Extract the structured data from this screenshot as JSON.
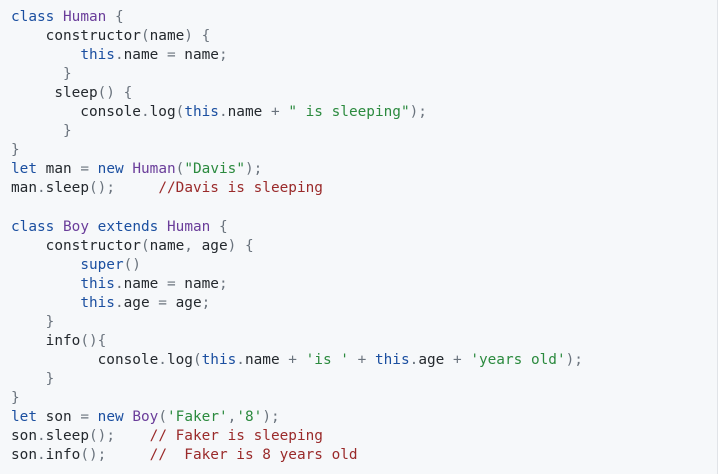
{
  "editor": {
    "lines": [
      [
        {
          "t": "class",
          "k": "kw"
        },
        {
          "t": " "
        },
        {
          "t": "Human",
          "k": "cls"
        },
        {
          "t": " "
        },
        {
          "t": "{",
          "k": "pun"
        }
      ],
      [
        {
          "t": "    constructor"
        },
        {
          "t": "(",
          "k": "pun"
        },
        {
          "t": "name"
        },
        {
          "t": ")",
          "k": "pun"
        },
        {
          "t": " "
        },
        {
          "t": "{",
          "k": "pun"
        }
      ],
      [
        {
          "t": "        "
        },
        {
          "t": "this",
          "k": "kw"
        },
        {
          "t": ".",
          "k": "pun"
        },
        {
          "t": "name "
        },
        {
          "t": "=",
          "k": "pun"
        },
        {
          "t": " name"
        },
        {
          "t": ";",
          "k": "pun"
        }
      ],
      [
        {
          "t": "      "
        },
        {
          "t": "}",
          "k": "pun"
        }
      ],
      [
        {
          "t": "     sleep"
        },
        {
          "t": "()",
          "k": "pun"
        },
        {
          "t": " "
        },
        {
          "t": "{",
          "k": "pun"
        }
      ],
      [
        {
          "t": "        console"
        },
        {
          "t": ".",
          "k": "pun"
        },
        {
          "t": "log"
        },
        {
          "t": "(",
          "k": "pun"
        },
        {
          "t": "this",
          "k": "kw"
        },
        {
          "t": ".",
          "k": "pun"
        },
        {
          "t": "name "
        },
        {
          "t": "+",
          "k": "pun"
        },
        {
          "t": " "
        },
        {
          "t": "\" is sleeping\"",
          "k": "str"
        },
        {
          "t": ");",
          "k": "pun"
        }
      ],
      [
        {
          "t": "      "
        },
        {
          "t": "}",
          "k": "pun"
        }
      ],
      [
        {
          "t": "}",
          "k": "pun"
        }
      ],
      [
        {
          "t": "let",
          "k": "kw"
        },
        {
          "t": " man "
        },
        {
          "t": "=",
          "k": "pun"
        },
        {
          "t": " "
        },
        {
          "t": "new",
          "k": "kw"
        },
        {
          "t": " "
        },
        {
          "t": "Human",
          "k": "cls"
        },
        {
          "t": "(",
          "k": "pun"
        },
        {
          "t": "\"Davis\"",
          "k": "str"
        },
        {
          "t": ");",
          "k": "pun"
        }
      ],
      [
        {
          "t": "man"
        },
        {
          "t": ".",
          "k": "pun"
        },
        {
          "t": "sleep"
        },
        {
          "t": "();",
          "k": "pun"
        },
        {
          "t": "     "
        },
        {
          "t": "//Davis is sleeping",
          "k": "com"
        }
      ],
      [
        {
          "t": ""
        }
      ],
      [
        {
          "t": "class",
          "k": "kw"
        },
        {
          "t": " "
        },
        {
          "t": "Boy",
          "k": "cls"
        },
        {
          "t": " "
        },
        {
          "t": "extends",
          "k": "kw"
        },
        {
          "t": " "
        },
        {
          "t": "Human",
          "k": "cls"
        },
        {
          "t": " "
        },
        {
          "t": "{",
          "k": "pun"
        }
      ],
      [
        {
          "t": "    constructor"
        },
        {
          "t": "(",
          "k": "pun"
        },
        {
          "t": "name"
        },
        {
          "t": ",",
          "k": "pun"
        },
        {
          "t": " age"
        },
        {
          "t": ")",
          "k": "pun"
        },
        {
          "t": " "
        },
        {
          "t": "{",
          "k": "pun"
        }
      ],
      [
        {
          "t": "        "
        },
        {
          "t": "super",
          "k": "kw"
        },
        {
          "t": "()",
          "k": "pun"
        }
      ],
      [
        {
          "t": "        "
        },
        {
          "t": "this",
          "k": "kw"
        },
        {
          "t": ".",
          "k": "pun"
        },
        {
          "t": "name "
        },
        {
          "t": "=",
          "k": "pun"
        },
        {
          "t": " name"
        },
        {
          "t": ";",
          "k": "pun"
        }
      ],
      [
        {
          "t": "        "
        },
        {
          "t": "this",
          "k": "kw"
        },
        {
          "t": ".",
          "k": "pun"
        },
        {
          "t": "age "
        },
        {
          "t": "=",
          "k": "pun"
        },
        {
          "t": " age"
        },
        {
          "t": ";",
          "k": "pun"
        }
      ],
      [
        {
          "t": "    "
        },
        {
          "t": "}",
          "k": "pun"
        }
      ],
      [
        {
          "t": "    info"
        },
        {
          "t": "(){",
          "k": "pun"
        }
      ],
      [
        {
          "t": "          console"
        },
        {
          "t": ".",
          "k": "pun"
        },
        {
          "t": "log"
        },
        {
          "t": "(",
          "k": "pun"
        },
        {
          "t": "this",
          "k": "kw"
        },
        {
          "t": ".",
          "k": "pun"
        },
        {
          "t": "name "
        },
        {
          "t": "+",
          "k": "pun"
        },
        {
          "t": " "
        },
        {
          "t": "'is '",
          "k": "str"
        },
        {
          "t": " "
        },
        {
          "t": "+",
          "k": "pun"
        },
        {
          "t": " "
        },
        {
          "t": "this",
          "k": "kw"
        },
        {
          "t": ".",
          "k": "pun"
        },
        {
          "t": "age "
        },
        {
          "t": "+",
          "k": "pun"
        },
        {
          "t": " "
        },
        {
          "t": "'years old'",
          "k": "str"
        },
        {
          "t": ");",
          "k": "pun"
        }
      ],
      [
        {
          "t": "    "
        },
        {
          "t": "}",
          "k": "pun"
        }
      ],
      [
        {
          "t": "}",
          "k": "pun"
        }
      ],
      [
        {
          "t": "let",
          "k": "kw"
        },
        {
          "t": " son "
        },
        {
          "t": "=",
          "k": "pun"
        },
        {
          "t": " "
        },
        {
          "t": "new",
          "k": "kw"
        },
        {
          "t": " "
        },
        {
          "t": "Boy",
          "k": "cls"
        },
        {
          "t": "(",
          "k": "pun"
        },
        {
          "t": "'Faker'",
          "k": "str"
        },
        {
          "t": ",",
          "k": "pun"
        },
        {
          "t": "'8'",
          "k": "str"
        },
        {
          "t": ");",
          "k": "pun"
        }
      ],
      [
        {
          "t": "son"
        },
        {
          "t": ".",
          "k": "pun"
        },
        {
          "t": "sleep"
        },
        {
          "t": "();",
          "k": "pun"
        },
        {
          "t": "    "
        },
        {
          "t": "// Faker is sleeping",
          "k": "com"
        }
      ],
      [
        {
          "t": "son"
        },
        {
          "t": ".",
          "k": "pun"
        },
        {
          "t": "info"
        },
        {
          "t": "();",
          "k": "pun"
        },
        {
          "t": "     "
        },
        {
          "t": "//  Faker is 8 years old",
          "k": "com"
        }
      ]
    ]
  },
  "colors": {
    "background": "#f6f8fa",
    "keyword": "#1b4fa0",
    "class_name": "#6a3d9a",
    "string": "#2b8a3e",
    "comment": "#9a2a2a",
    "punctuation": "#6a737d",
    "identifier": "#24292e"
  }
}
